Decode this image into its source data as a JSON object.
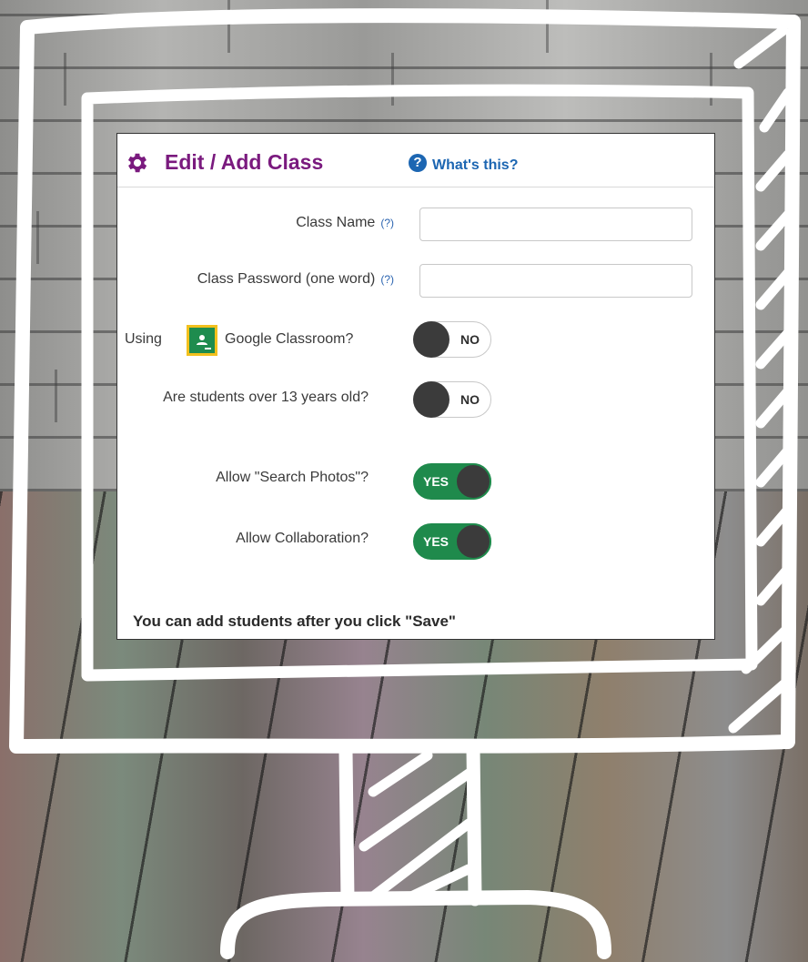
{
  "header": {
    "title": "Edit / Add Class",
    "help_icon": "?",
    "help_link": "What's this?"
  },
  "form": {
    "class_name_label": "Class Name",
    "class_name_hint": "(?)",
    "class_name_value": "",
    "class_password_label": "Class Password (one word)",
    "class_password_hint": "(?)",
    "class_password_value": "",
    "google_prefix": "Using",
    "google_suffix": "Google Classroom?",
    "over13_label": "Are students over 13 years old?",
    "search_photos_label": "Allow \"Search Photos\"?",
    "collaboration_label": "Allow Collaboration?"
  },
  "toggles": {
    "google_classroom": "NO",
    "over13": "NO",
    "search_photos": "YES",
    "collaboration": "YES"
  },
  "footer_note": "You can add students after you click \"Save\"",
  "colors": {
    "title": "#7a1a7e",
    "link": "#1c66b2",
    "toggle_on": "#1f8a4c",
    "knob": "#3b3b3b"
  },
  "icons": {
    "settings": "gear-icon",
    "help": "question-circle-icon",
    "classroom": "google-classroom-icon"
  }
}
